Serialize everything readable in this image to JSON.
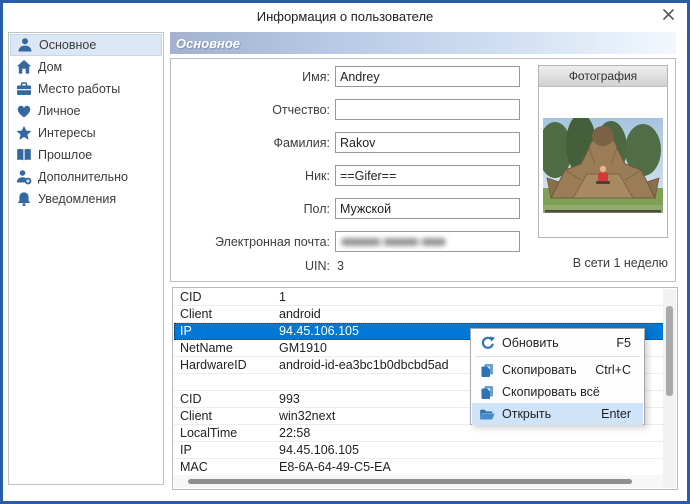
{
  "window": {
    "title": "Информация о пользователе",
    "close_icon": "close-x"
  },
  "sidebar": {
    "items": [
      {
        "icon": "person-icon",
        "label": "Основное",
        "selected": true
      },
      {
        "icon": "home-icon",
        "label": "Дом",
        "selected": false
      },
      {
        "icon": "briefcase-icon",
        "label": "Место работы",
        "selected": false
      },
      {
        "icon": "heart-icon",
        "label": "Личное",
        "selected": false
      },
      {
        "icon": "star-icon",
        "label": "Интересы",
        "selected": false
      },
      {
        "icon": "book-icon",
        "label": "Прошлое",
        "selected": false
      },
      {
        "icon": "person-plus-icon",
        "label": "Дополнительно",
        "selected": false
      },
      {
        "icon": "bell-icon",
        "label": "Уведомления",
        "selected": false
      }
    ]
  },
  "main": {
    "section_header": "Основное",
    "form": {
      "fields": [
        {
          "label": "Имя:",
          "value": "Andrey",
          "obscured": false
        },
        {
          "label": "Отчество:",
          "value": "",
          "obscured": false
        },
        {
          "label": "Фамилия:",
          "value": "Rakov",
          "obscured": false
        },
        {
          "label": "Ник:",
          "value": "==Gifer==",
          "obscured": false
        },
        {
          "label": "Пол:",
          "value": "Мужской",
          "obscured": false
        },
        {
          "label": "Электронная почта:",
          "value": "",
          "obscured": true
        }
      ],
      "uin_label": "UIN:",
      "uin_value": "3"
    },
    "photo_panel": {
      "header": "Фотография"
    },
    "online_status": "В сети 1 неделю"
  },
  "details_table": {
    "rows": [
      {
        "key": "CID",
        "value": "1",
        "selected": false
      },
      {
        "key": "Client",
        "value": "android",
        "selected": false
      },
      {
        "key": "IP",
        "value": "94.45.106.105",
        "selected": true
      },
      {
        "key": "NetName",
        "value": "GM1910",
        "selected": false
      },
      {
        "key": "HardwareID",
        "value": "android-id-ea3bc1b0dbcbd5ad",
        "selected": false
      },
      {
        "key": "",
        "value": "",
        "selected": false
      },
      {
        "key": "CID",
        "value": "993",
        "selected": false
      },
      {
        "key": "Client",
        "value": "win32next",
        "selected": false
      },
      {
        "key": "LocalTime",
        "value": "22:58",
        "selected": false
      },
      {
        "key": "IP",
        "value": "94.45.106.105",
        "selected": false
      },
      {
        "key": "MAC",
        "value": "E8-6A-64-49-C5-EA",
        "selected": false
      }
    ]
  },
  "context_menu": {
    "items": [
      {
        "icon": "refresh-icon",
        "label": "Обновить",
        "shortcut": "F5",
        "highlighted": false
      },
      {
        "icon": "copy-icon",
        "label": "Скопировать",
        "shortcut": "Ctrl+C",
        "highlighted": false
      },
      {
        "icon": "copy-all-icon",
        "label": "Скопировать всё",
        "shortcut": "",
        "highlighted": false
      },
      {
        "icon": "open-folder-icon",
        "label": "Открыть",
        "shortcut": "Enter",
        "highlighted": true
      }
    ]
  },
  "colors": {
    "window_border": "#2b5ca9",
    "selection_blue": "#0078d7",
    "icon_blue": "#35689e",
    "menu_highlight": "#cfe4f8",
    "sidebar_selected": "#dce7f5"
  }
}
